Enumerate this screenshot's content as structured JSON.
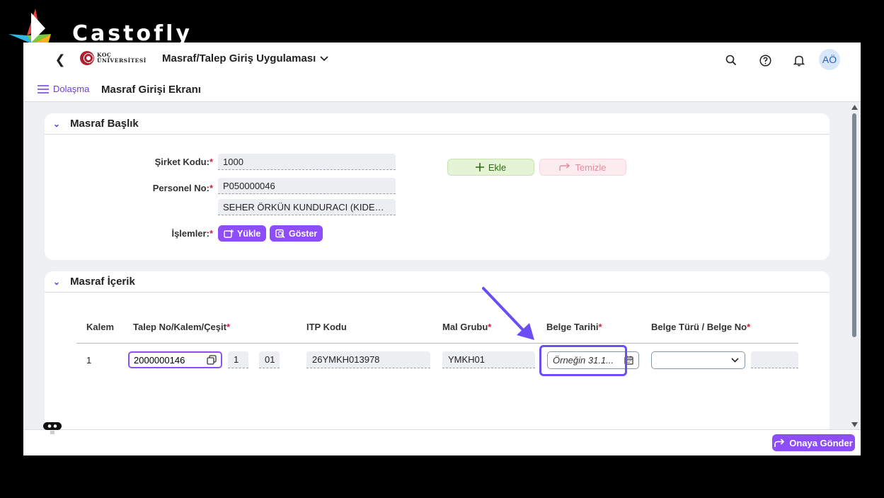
{
  "brand": {
    "name": "Castofly"
  },
  "shell": {
    "logo_line1": "KOÇ",
    "logo_line2": "ÜNİVERSİTESİ",
    "app_title": "Masraf/Talep Giriş Uygulaması",
    "avatar": "AÖ"
  },
  "subbar": {
    "nav_label": "Dolaşma",
    "page_title": "Masraf Girişi Ekranı"
  },
  "header_panel": {
    "title": "Masraf Başlık",
    "company_code_label": "Şirket Kodu:",
    "company_code": "1000",
    "personnel_label": "Personel No:",
    "personnel_no": "P050000046",
    "personnel_name": "SEHER ÖRKÜN KUNDURACI (KIDEMLI...",
    "operations_label": "İşlemler:",
    "upload_label": "Yükle",
    "show_label": "Göster",
    "add_label": "Ekle",
    "clear_label": "Temizle"
  },
  "content_panel": {
    "title": "Masraf İçerik",
    "columns": {
      "item": "Kalem",
      "request": "Talep No/Kalem/Çeşit",
      "itp": "ITP Kodu",
      "material_group": "Mal Grubu",
      "doc_date": "Belge Tarihi",
      "doc_type": "Belge Türü / Belge No"
    },
    "row": {
      "item": "1",
      "request_no": "2000000146",
      "request_item": "1",
      "request_type": "01",
      "itp_code": "26YMKH013978",
      "material_group": "YMKH01",
      "doc_date_placeholder": "Örneğin 31.1...",
      "doc_type": ""
    }
  },
  "footer": {
    "submit_label": "Onaya Gönder"
  },
  "colors": {
    "accent": "#8d4ef7",
    "arrow": "#6c4df6",
    "required": "#d1203a"
  }
}
